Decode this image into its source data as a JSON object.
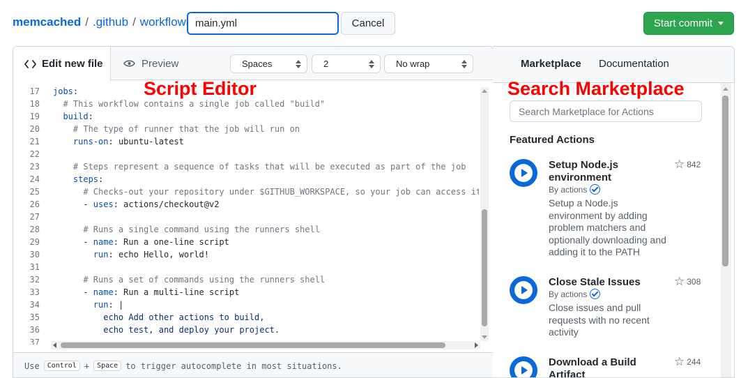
{
  "header": {
    "breadcrumb": {
      "repo": "memcached",
      "sep1": "/",
      "folder1": ".github",
      "sep2": "/",
      "folder2": "workflows",
      "sep3": "/"
    },
    "filename_value": "main.yml",
    "cancel_label": "Cancel",
    "commit_label": "Start commit"
  },
  "editor": {
    "tab_edit": "Edit new file",
    "tab_preview": "Preview",
    "indent_mode": "Spaces",
    "indent_size": "2",
    "wrap_mode": "No wrap",
    "lines": [
      {
        "n": "17",
        "indent": "",
        "key": "jobs",
        "sep": ":",
        "rest": "",
        "comment": ""
      },
      {
        "n": "18",
        "indent": "  ",
        "key": "",
        "sep": "",
        "rest": "",
        "comment": "# This workflow contains a single job called \"build\""
      },
      {
        "n": "19",
        "indent": "  ",
        "key": "build",
        "sep": ":",
        "rest": "",
        "comment": ""
      },
      {
        "n": "20",
        "indent": "    ",
        "key": "",
        "sep": "",
        "rest": "",
        "comment": "# The type of runner that the job will run on"
      },
      {
        "n": "21",
        "indent": "    ",
        "key": "runs-on",
        "sep": ":",
        "rest": " ubuntu-latest",
        "comment": ""
      },
      {
        "n": "22",
        "indent": "",
        "key": "",
        "sep": "",
        "rest": "",
        "comment": ""
      },
      {
        "n": "23",
        "indent": "    ",
        "key": "",
        "sep": "",
        "rest": "",
        "comment": "# Steps represent a sequence of tasks that will be executed as part of the job"
      },
      {
        "n": "24",
        "indent": "    ",
        "key": "steps",
        "sep": ":",
        "rest": "",
        "comment": ""
      },
      {
        "n": "25",
        "indent": "      ",
        "key": "",
        "sep": "",
        "rest": "",
        "comment": "# Checks-out your repository under $GITHUB_WORKSPACE, so your job can access it"
      },
      {
        "n": "26",
        "indent": "      - ",
        "key": "uses",
        "sep": ":",
        "rest": " actions/checkout@v2",
        "comment": ""
      },
      {
        "n": "27",
        "indent": "",
        "key": "",
        "sep": "",
        "rest": "",
        "comment": ""
      },
      {
        "n": "28",
        "indent": "      ",
        "key": "",
        "sep": "",
        "rest": "",
        "comment": "# Runs a single command using the runners shell"
      },
      {
        "n": "29",
        "indent": "      - ",
        "key": "name",
        "sep": ":",
        "rest": " Run a one-line script",
        "comment": ""
      },
      {
        "n": "30",
        "indent": "        ",
        "key": "run",
        "sep": ":",
        "rest": " echo Hello, world!",
        "comment": ""
      },
      {
        "n": "31",
        "indent": "",
        "key": "",
        "sep": "",
        "rest": "",
        "comment": ""
      },
      {
        "n": "32",
        "indent": "      ",
        "key": "",
        "sep": "",
        "rest": "",
        "comment": "# Runs a set of commands using the runners shell"
      },
      {
        "n": "33",
        "indent": "      - ",
        "key": "name",
        "sep": ":",
        "rest": " Run a multi-line script",
        "comment": ""
      },
      {
        "n": "34",
        "indent": "        ",
        "key": "run",
        "sep": ":",
        "rest": " |",
        "comment": ""
      },
      {
        "n": "35",
        "indent": "          ",
        "key": "",
        "sep": "",
        "rest": "echo Add other actions to build,",
        "comment": "",
        "plain": true
      },
      {
        "n": "36",
        "indent": "          ",
        "key": "",
        "sep": "",
        "rest": "echo test, and deploy your project.",
        "comment": "",
        "plain": true
      },
      {
        "n": "37",
        "indent": "",
        "key": "",
        "sep": "",
        "rest": "",
        "comment": ""
      }
    ],
    "footer": {
      "prefix": "Use",
      "key1": "Control",
      "plus": "+",
      "key2": "Space",
      "suffix": "to trigger autocomplete in most situations."
    }
  },
  "annotations": {
    "script_editor": "Script Editor",
    "search_marketplace": "Search Marketplace"
  },
  "marketplace": {
    "tab_marketplace": "Marketplace",
    "tab_documentation": "Documentation",
    "search_placeholder": "Search Marketplace for Actions",
    "featured_heading": "Featured Actions",
    "actions": [
      {
        "title": "Setup Node.js environment",
        "by": "By actions",
        "description": "Setup a Node.js environment by adding problem matchers and optionally downloading and adding it to the PATH",
        "stars": "842"
      },
      {
        "title": "Close Stale Issues",
        "by": "By actions",
        "description": "Close issues and pull requests with no recent activity",
        "stars": "308"
      },
      {
        "title": "Download a Build Artifact",
        "by": "By actions",
        "description": "",
        "stars": "244"
      }
    ]
  },
  "colors": {
    "accent": "#0969da",
    "commit_green": "#2da44e",
    "annotation_red": "#ff0000",
    "yaml_key": "#0550ae",
    "yaml_comment": "#6e7781"
  }
}
